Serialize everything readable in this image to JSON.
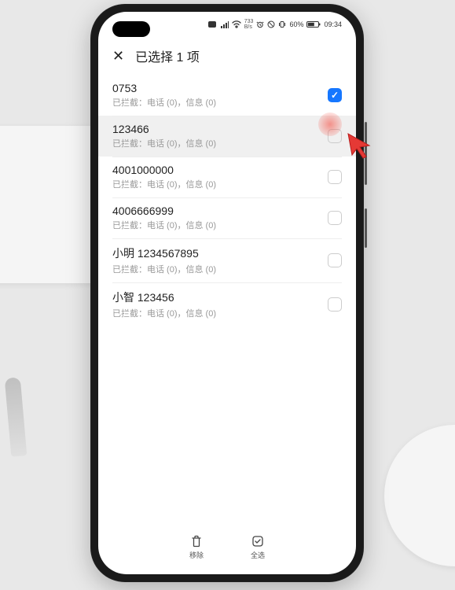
{
  "status_bar": {
    "speed": "733",
    "speed_unit": "B/s",
    "battery_pct": "60%",
    "time": "09:34"
  },
  "header": {
    "close_glyph": "✕",
    "title": "已选择 1 项"
  },
  "list": [
    {
      "title": "0753",
      "sub": "已拦截：电话 (0)，信息 (0)",
      "checked": true,
      "highlighted": false
    },
    {
      "title": "123466",
      "sub": "已拦截：电话 (0)，信息 (0)",
      "checked": false,
      "highlighted": true
    },
    {
      "title": "4001000000",
      "sub": "已拦截：电话 (0)，信息 (0)",
      "checked": false,
      "highlighted": false
    },
    {
      "title": "4006666999",
      "sub": "已拦截：电话 (0)，信息 (0)",
      "checked": false,
      "highlighted": false
    },
    {
      "title": "小明 1234567895",
      "sub": "已拦截：电话 (0)，信息 (0)",
      "checked": false,
      "highlighted": false
    },
    {
      "title": "小智 123456",
      "sub": "已拦截：电话 (0)，信息 (0)",
      "checked": false,
      "highlighted": false
    }
  ],
  "bottom": {
    "remove_label": "移除",
    "select_all_label": "全选"
  }
}
